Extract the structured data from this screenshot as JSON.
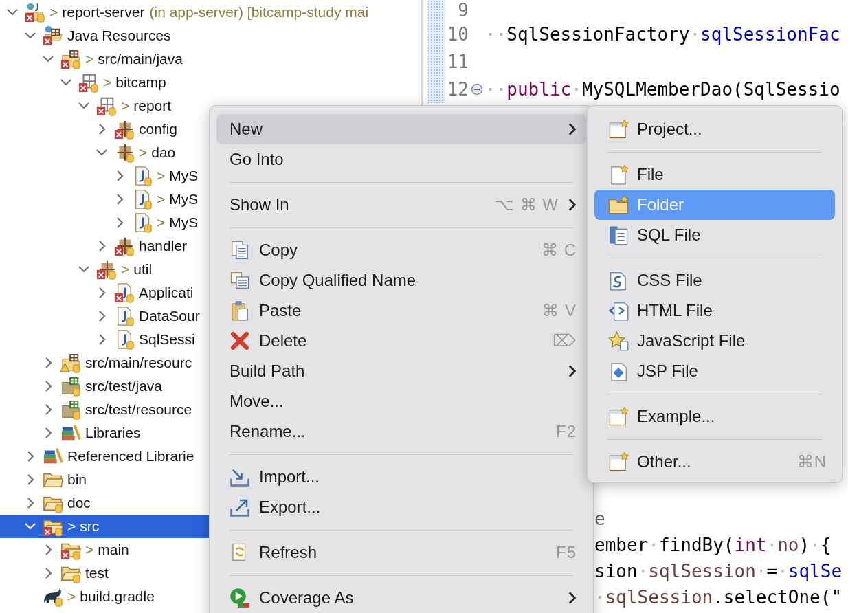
{
  "tree": [
    {
      "label": "report-server",
      "decoration": "(in app-server) [bitcamp-study mai",
      "kind": "project",
      "marker": ">",
      "error": true,
      "warning": false,
      "tracked": true,
      "expandable": true,
      "expanded": true,
      "selected": false,
      "children": [
        {
          "label": "Java Resources",
          "kind": "java-resources",
          "error": true,
          "warning": false,
          "tracked": false,
          "expandable": true,
          "expanded": true,
          "selected": false,
          "children": [
            {
              "label": "src/main/java",
              "kind": "source-folder",
              "marker": ">",
              "error": true,
              "warning": false,
              "tracked": true,
              "expandable": true,
              "expanded": true,
              "selected": false,
              "children": [
                {
                  "label": "bitcamp",
                  "kind": "package-empty",
                  "marker": ">",
                  "error": true,
                  "warning": false,
                  "tracked": true,
                  "expandable": true,
                  "expanded": true,
                  "selected": false,
                  "children": [
                    {
                      "label": "report",
                      "kind": "package-empty",
                      "marker": ">",
                      "error": true,
                      "warning": false,
                      "tracked": true,
                      "expandable": true,
                      "expanded": true,
                      "selected": false,
                      "children": [
                        {
                          "label": "config",
                          "kind": "package",
                          "error": true,
                          "warning": false,
                          "tracked": true,
                          "expandable": true,
                          "expanded": false,
                          "selected": false
                        },
                        {
                          "label": "dao",
                          "kind": "package",
                          "marker": ">",
                          "error": false,
                          "warning": false,
                          "tracked": true,
                          "expandable": true,
                          "expanded": true,
                          "selected": false,
                          "children": [
                            {
                              "label": "MyS",
                              "kind": "java-file",
                              "marker": ">",
                              "error": false,
                              "warning": false,
                              "tracked": true,
                              "expandable": true,
                              "expanded": false,
                              "selected": false
                            },
                            {
                              "label": "MyS",
                              "kind": "java-file",
                              "marker": ">",
                              "error": false,
                              "warning": false,
                              "tracked": true,
                              "expandable": true,
                              "expanded": false,
                              "selected": false
                            },
                            {
                              "label": "MyS",
                              "kind": "java-file",
                              "marker": ">",
                              "error": false,
                              "warning": false,
                              "tracked": true,
                              "expandable": true,
                              "expanded": false,
                              "selected": false
                            }
                          ]
                        },
                        {
                          "label": "handler",
                          "kind": "package",
                          "error": true,
                          "warning": false,
                          "tracked": true,
                          "expandable": true,
                          "expanded": false,
                          "selected": false
                        }
                      ]
                    },
                    {
                      "label": "util",
                      "kind": "package",
                      "marker": ">",
                      "error": true,
                      "warning": false,
                      "tracked": true,
                      "expandable": true,
                      "expanded": true,
                      "selected": false,
                      "children": [
                        {
                          "label": "Applicati",
                          "kind": "java-file",
                          "error": true,
                          "warning": false,
                          "tracked": true,
                          "expandable": true,
                          "expanded": false,
                          "selected": false
                        },
                        {
                          "label": "DataSour",
                          "kind": "java-file",
                          "error": false,
                          "warning": false,
                          "tracked": true,
                          "expandable": true,
                          "expanded": false,
                          "selected": false
                        },
                        {
                          "label": "SqlSessi",
                          "kind": "java-file",
                          "error": false,
                          "warning": false,
                          "tracked": true,
                          "expandable": true,
                          "expanded": false,
                          "selected": false
                        }
                      ]
                    }
                  ]
                }
              ]
            },
            {
              "label": "src/main/resourc",
              "kind": "source-folder",
              "error": false,
              "warning": true,
              "tracked": true,
              "expandable": true,
              "expanded": false,
              "selected": false
            },
            {
              "label": "src/test/java",
              "kind": "test-folder",
              "error": false,
              "warning": false,
              "tracked": true,
              "expandable": true,
              "expanded": false,
              "selected": false
            },
            {
              "label": "src/test/resource",
              "kind": "test-folder",
              "error": false,
              "warning": false,
              "tracked": true,
              "expandable": true,
              "expanded": false,
              "selected": false
            },
            {
              "label": "Libraries",
              "kind": "library",
              "error": false,
              "warning": false,
              "tracked": false,
              "expandable": true,
              "expanded": false,
              "selected": false
            }
          ]
        },
        {
          "label": "Referenced Librarie",
          "kind": "library",
          "error": false,
          "warning": false,
          "tracked": false,
          "expandable": true,
          "expanded": false,
          "selected": false
        },
        {
          "label": "bin",
          "kind": "folder",
          "error": false,
          "warning": false,
          "tracked": false,
          "expandable": true,
          "expanded": false,
          "selected": false
        },
        {
          "label": "doc",
          "kind": "folder",
          "error": false,
          "warning": false,
          "tracked": true,
          "expandable": true,
          "expanded": false,
          "selected": false
        },
        {
          "label": "src",
          "kind": "folder",
          "marker": ">",
          "error": true,
          "warning": false,
          "tracked": true,
          "expandable": true,
          "expanded": true,
          "selected": true,
          "children": [
            {
              "label": "main",
              "kind": "folder",
              "marker": ">",
              "error": true,
              "warning": false,
              "tracked": true,
              "expandable": true,
              "expanded": false,
              "selected": false
            },
            {
              "label": "test",
              "kind": "folder",
              "error": false,
              "warning": false,
              "tracked": true,
              "expandable": true,
              "expanded": false,
              "selected": false
            }
          ]
        },
        {
          "label": "build.gradle",
          "kind": "gradle",
          "marker": ">",
          "error": false,
          "warning": false,
          "tracked": true,
          "expandable": false,
          "expanded": false,
          "selected": false
        }
      ]
    }
  ],
  "editor": {
    "lines": [
      {
        "number": "9",
        "fold": false
      },
      {
        "number": "10",
        "fold": false,
        "tokens": [
          {
            "kind": "ws",
            "text": "··"
          },
          {
            "kind": "plain",
            "text": "SqlSessionFactory"
          },
          {
            "kind": "ws",
            "text": "·"
          },
          {
            "kind": "field",
            "text": "sqlSessionFac"
          }
        ]
      },
      {
        "number": "11",
        "fold": false
      },
      {
        "number": "12",
        "fold": true,
        "tokens": [
          {
            "kind": "ws",
            "text": "··"
          },
          {
            "kind": "keyword",
            "text": "public"
          },
          {
            "kind": "ws",
            "text": "·"
          },
          {
            "kind": "plain",
            "text": "MySQLMemberDao(SqlSessio"
          }
        ]
      }
    ],
    "visible_fragments": [
      [
        {
          "kind": "annotation",
          "text": "e"
        }
      ],
      [
        {
          "kind": "plain",
          "text": "ember"
        },
        {
          "kind": "ws",
          "text": "·"
        },
        {
          "kind": "plain",
          "text": "findBy("
        },
        {
          "kind": "keyword",
          "text": "int"
        },
        {
          "kind": "ws",
          "text": "·"
        },
        {
          "kind": "local",
          "text": "no"
        },
        {
          "kind": "plain",
          "text": ")"
        },
        {
          "kind": "ws",
          "text": "·"
        },
        {
          "kind": "plain",
          "text": "{"
        }
      ],
      [
        {
          "kind": "plain",
          "text": "sion"
        },
        {
          "kind": "ws",
          "text": "·"
        },
        {
          "kind": "local",
          "text": "sqlSession"
        },
        {
          "kind": "ws",
          "text": "·"
        },
        {
          "kind": "plain",
          "text": "="
        },
        {
          "kind": "ws",
          "text": "·"
        },
        {
          "kind": "field",
          "text": "sqlSe"
        }
      ],
      [
        {
          "kind": "ws",
          "text": "·"
        },
        {
          "kind": "local",
          "text": "sqlSession"
        },
        {
          "kind": "plain",
          "text": ".selectOne(\""
        }
      ]
    ]
  },
  "context_menu": [
    {
      "kind": "plain",
      "label": "New",
      "submenu": true,
      "selected": true
    },
    {
      "kind": "plain",
      "label": "Go Into",
      "submenu": false,
      "selected": false
    },
    {
      "kind": "separator"
    },
    {
      "kind": "plain",
      "label": "Show In",
      "shortcut": "⌥ ⌘ W",
      "submenu": true,
      "selected": false
    },
    {
      "kind": "separator"
    },
    {
      "kind": "copy",
      "label": "Copy",
      "shortcut": "⌘ C",
      "submenu": false,
      "selected": false
    },
    {
      "kind": "copy-qualified",
      "label": "Copy Qualified Name",
      "submenu": false,
      "selected": false
    },
    {
      "kind": "paste",
      "label": "Paste",
      "shortcut": "⌘ V",
      "submenu": false,
      "selected": false
    },
    {
      "kind": "delete",
      "label": "Delete",
      "shortcut": "⌦",
      "submenu": false,
      "selected": false
    },
    {
      "kind": "plain",
      "label": "Build Path",
      "submenu": true,
      "selected": false
    },
    {
      "kind": "plain",
      "label": "Move...",
      "submenu": false,
      "selected": false
    },
    {
      "kind": "plain",
      "label": "Rename...",
      "shortcut": "F2",
      "submenu": false,
      "selected": false
    },
    {
      "kind": "separator"
    },
    {
      "kind": "import",
      "label": "Import...",
      "submenu": false,
      "selected": false
    },
    {
      "kind": "export",
      "label": "Export...",
      "submenu": false,
      "selected": false
    },
    {
      "kind": "separator"
    },
    {
      "kind": "refresh",
      "label": "Refresh",
      "shortcut": "F5",
      "submenu": false,
      "selected": false
    },
    {
      "kind": "separator"
    },
    {
      "kind": "coverage",
      "label": "Coverage As",
      "submenu": true,
      "selected": false
    }
  ],
  "new_submenu": [
    {
      "kind": "wizard",
      "label": "Project...",
      "submenu": false,
      "selected": false
    },
    {
      "kind": "separator"
    },
    {
      "kind": "file",
      "label": "File",
      "submenu": false,
      "selected": false
    },
    {
      "kind": "folder",
      "label": "Folder",
      "submenu": false,
      "selected": true
    },
    {
      "kind": "sql",
      "label": "SQL File",
      "submenu": false,
      "selected": false
    },
    {
      "kind": "separator"
    },
    {
      "kind": "css",
      "label": "CSS File",
      "submenu": false,
      "selected": false
    },
    {
      "kind": "html",
      "label": "HTML File",
      "submenu": false,
      "selected": false
    },
    {
      "kind": "js",
      "label": "JavaScript File",
      "submenu": false,
      "selected": false
    },
    {
      "kind": "jsp",
      "label": "JSP File",
      "submenu": false,
      "selected": false
    },
    {
      "kind": "separator"
    },
    {
      "kind": "wizard",
      "label": "Example...",
      "submenu": false,
      "selected": false
    },
    {
      "kind": "separator"
    },
    {
      "kind": "wizard",
      "label": "Other...",
      "shortcut": "⌘N",
      "submenu": false,
      "selected": false
    }
  ]
}
